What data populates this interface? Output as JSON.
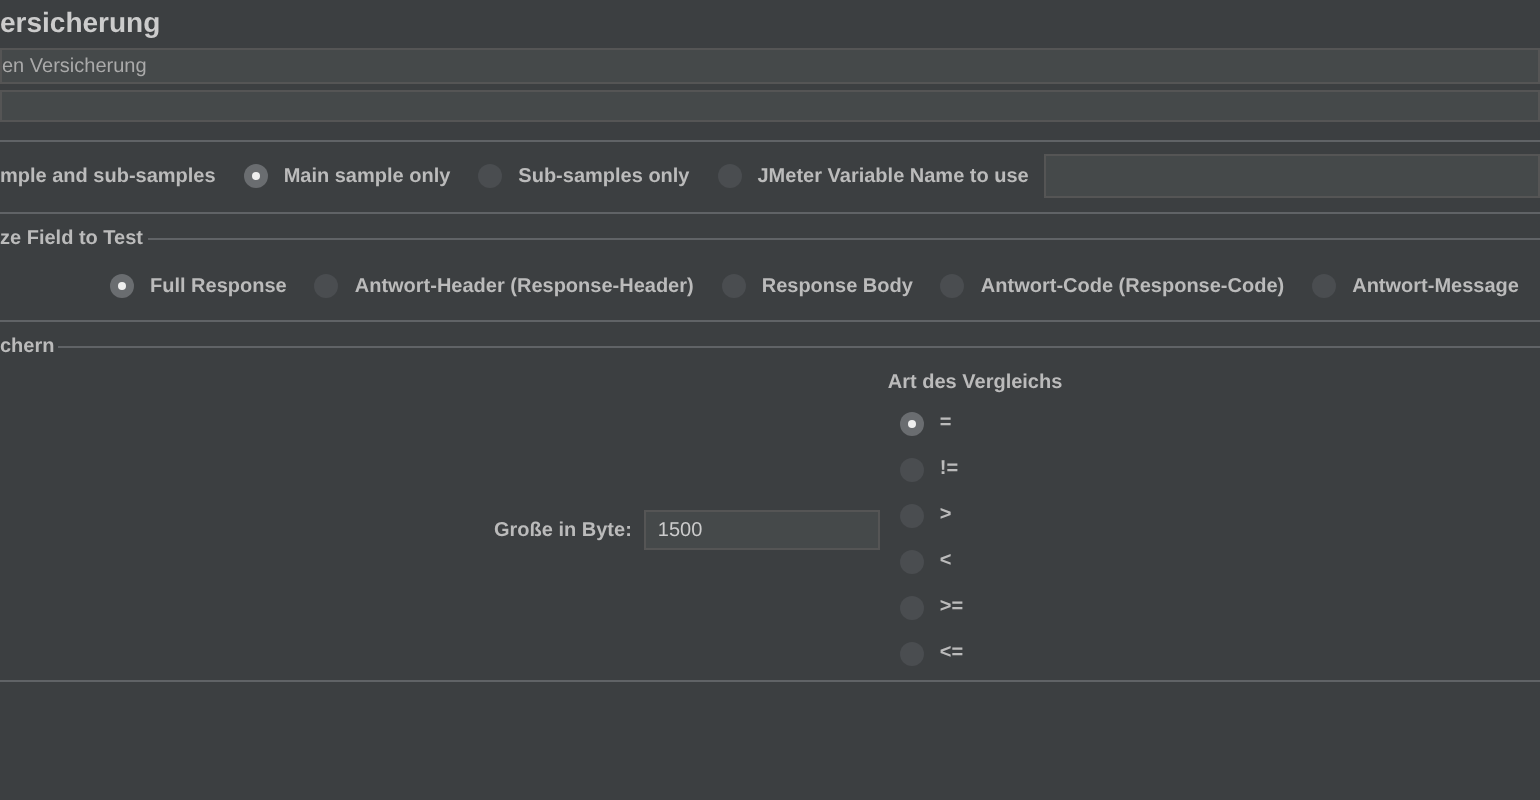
{
  "title": "ersicherung",
  "name_field": {
    "value": "en Versicherung"
  },
  "apply_to": {
    "options": [
      {
        "label": "mple and sub-samples",
        "kind": "cut"
      },
      {
        "label": "Main sample only",
        "selected": true,
        "kind": "radio"
      },
      {
        "label": "Sub-samples only",
        "selected": false,
        "kind": "radio"
      },
      {
        "label": "JMeter Variable Name to use",
        "selected": false,
        "kind": "radio"
      }
    ]
  },
  "field_to_test": {
    "legend": "ze Field to Test",
    "options": [
      {
        "label": "Full Response",
        "selected": true
      },
      {
        "label": "Antwort-Header (Response-Header)",
        "selected": false
      },
      {
        "label": "Response Body",
        "selected": false
      },
      {
        "label": "Antwort-Code (Response-Code)",
        "selected": false
      },
      {
        "label": "Antwort-Message",
        "selected": false
      }
    ]
  },
  "size_panel": {
    "legend": "chern",
    "size_label": "Große in Byte:",
    "size_field": {
      "value": "1500"
    },
    "comparison_title": "Art des Vergleichs",
    "comparisons": [
      {
        "label": "=",
        "selected": true
      },
      {
        "label": "!=",
        "selected": false
      },
      {
        "label": ">",
        "selected": false
      },
      {
        "label": "<",
        "selected": false
      },
      {
        "label": ">=",
        "selected": false
      },
      {
        "label": "<=",
        "selected": false
      }
    ]
  }
}
